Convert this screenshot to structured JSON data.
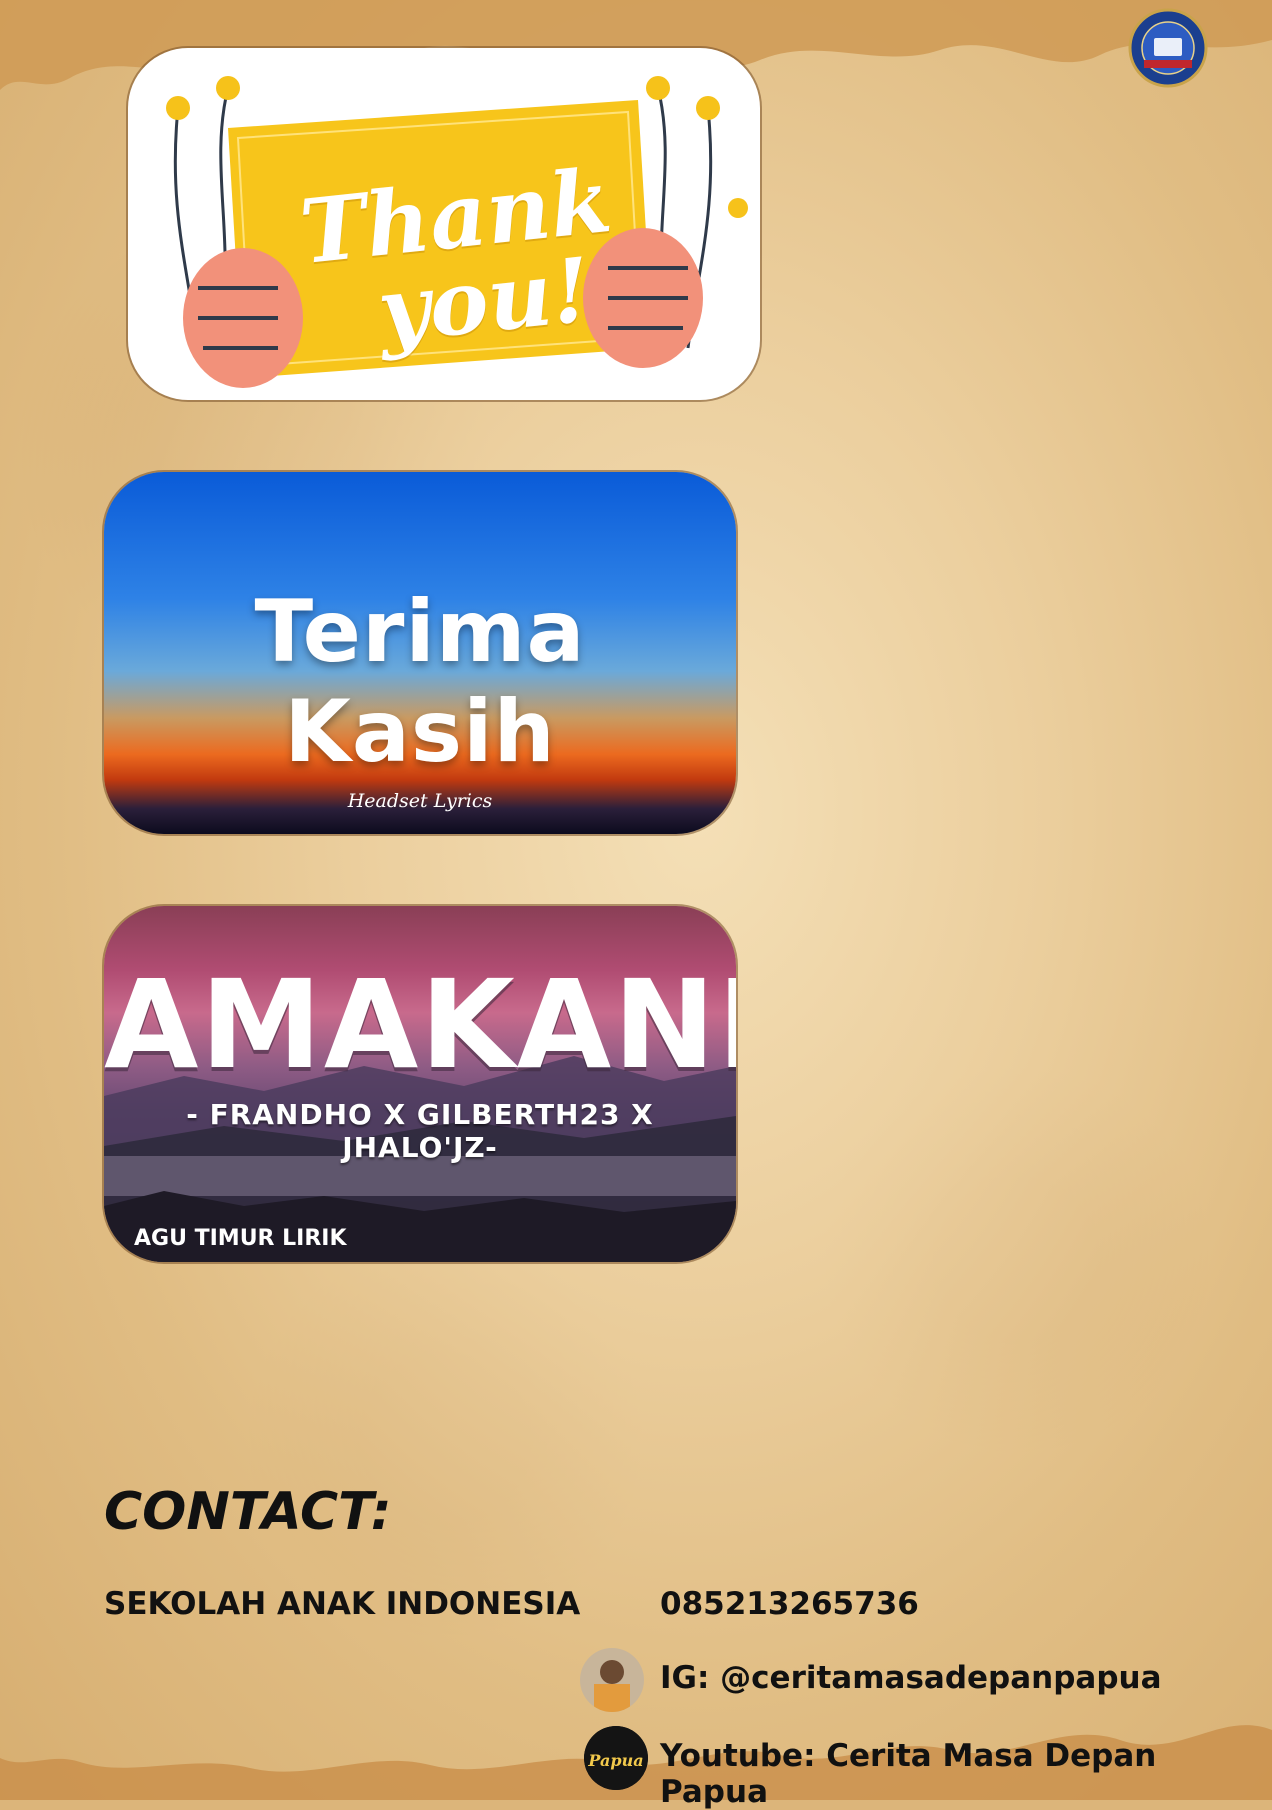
{
  "header": {
    "logo_text": "SEKOLAH ANAK INDONESIA"
  },
  "cards": {
    "thanks": {
      "line1": "Thank",
      "line2": "you!"
    },
    "terima": {
      "title": "Terima Kasih",
      "credit": "Headset Lyrics"
    },
    "amakane": {
      "title": "AMAKANE",
      "subtitle": "- FRANDHO X GILBERTH23 X JHALO'JZ-",
      "corner": "AGU TIMUR LIRIK"
    }
  },
  "contact": {
    "title": "CONTACT:",
    "school": "SEKOLAH ANAK INDONESIA",
    "phone": "085213265736",
    "instagram": "IG: @ceritamasadepanpapua",
    "youtube": "Youtube: Cerita Masa Depan Papua",
    "youtube_avatar_text": "Papua"
  },
  "colors": {
    "paper": "#e6c48c",
    "text": "#111111",
    "thanks_card": "#f7c51b"
  }
}
